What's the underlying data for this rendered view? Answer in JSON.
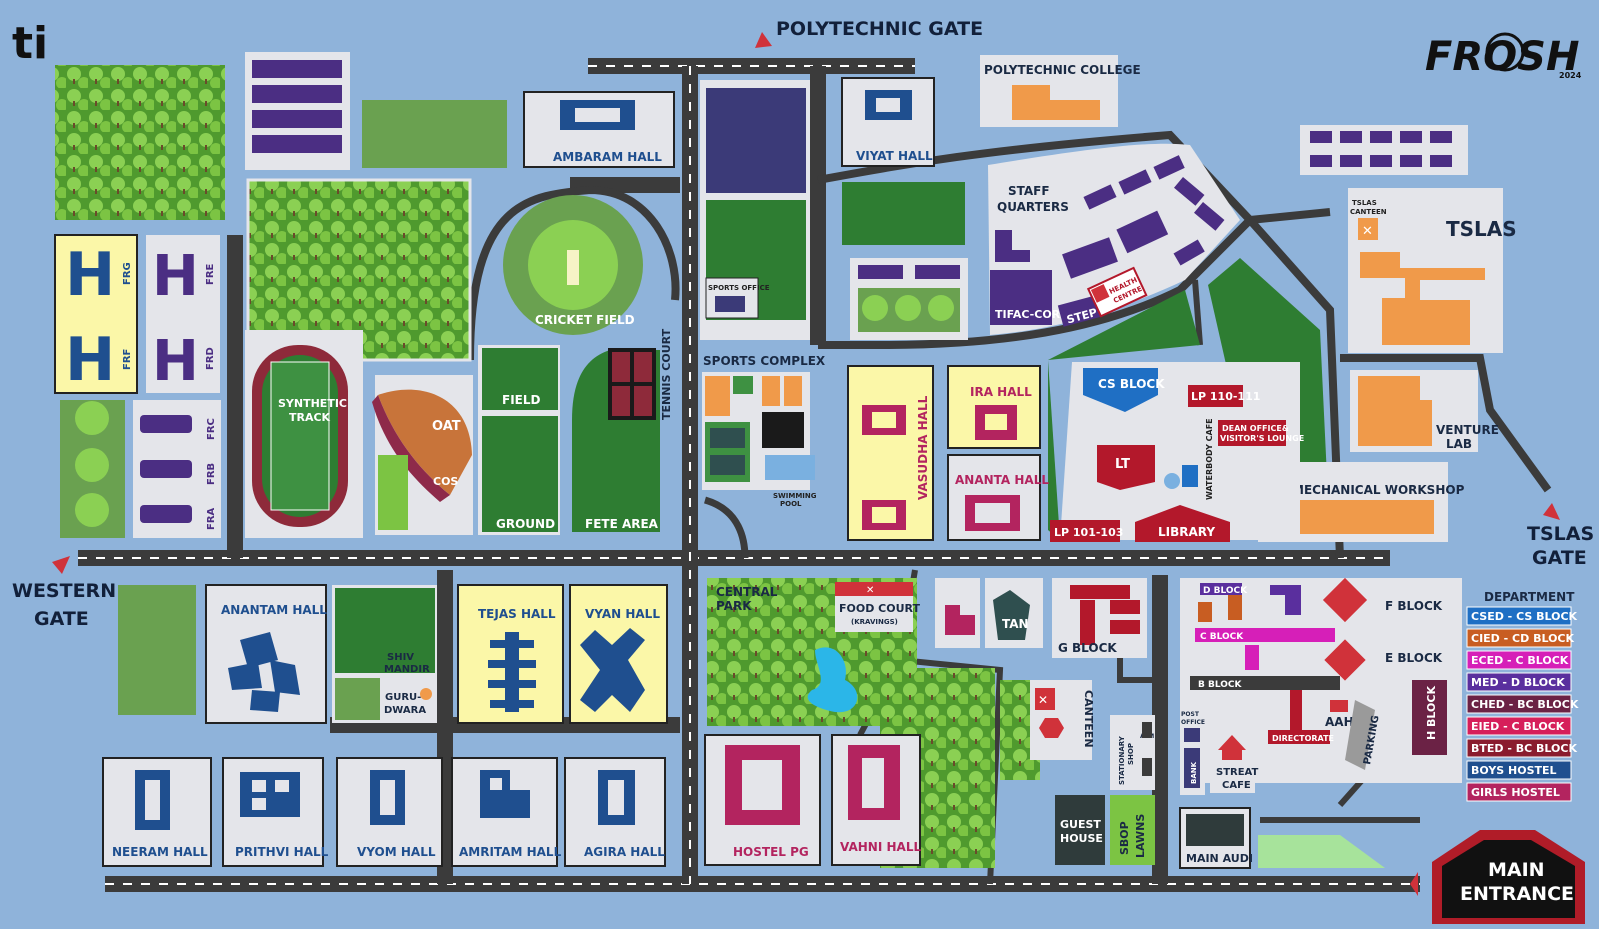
{
  "logo_left": "ti",
  "logo_right": {
    "text": "FROSH",
    "year": "2024"
  },
  "gates": {
    "polytechnic": "POLYTECHNIC GATE",
    "western_1": "WESTERN",
    "western_2": "GATE",
    "tslas_1": "TSLAS",
    "tslas_2": "GATE",
    "main_1": "MAIN",
    "main_2": "ENTRANCE"
  },
  "places": {
    "ambaram": "AMBARAM HALL",
    "viyat": "VIYAT HALL",
    "polytechnic_college": "POLYTECHNIC COLLEGE",
    "staff_1": "STAFF",
    "staff_2": "QUARTERS",
    "tifac": "TIFAC-CORE",
    "step": "STEP",
    "health_1": "HEALTH",
    "health_2": "CENTRE",
    "tslas": "TSLAS",
    "tslas_canteen_1": "TSLAS",
    "tslas_canteen_2": "CANTEEN",
    "frg": "FRG",
    "fre": "FRE",
    "frf": "FRF",
    "frd": "FRD",
    "frc": "FRC",
    "frb": "FRB",
    "fra": "FRA",
    "synthetic_1": "SYNTHETIC",
    "synthetic_2": "TRACK",
    "oat": "OAT",
    "cos": "COS",
    "cricket": "CRICKET FIELD",
    "field": "FIELD",
    "ground": "GROUND",
    "fete": "FETE AREA",
    "tennis": "TENNIS COURT",
    "sports_office": "SPORTS OFFICE",
    "sports_complex": "SPORTS COMPLEX",
    "swimming_1": "SWIMMING",
    "swimming_2": "POOL",
    "vasudha": "VASUDHA HALL",
    "ira": "IRA HALL",
    "ananta": "ANANTA HALL",
    "cs_block": "CS BLOCK",
    "lp110": "LP 110-111",
    "dean_1": "DEAN OFFICE&",
    "dean_2": "VISITOR'S LOUNGE",
    "lt": "LT",
    "waterbody": "WATERBODY CAFE",
    "lp101": "LP 101-103",
    "library": "LIBRARY",
    "venture_1": "VENTURE",
    "venture_2": "LAB",
    "workshop": "MECHANICAL WORKSHOP",
    "anantam": "ANANTAM HALL",
    "shiv_1": "SHIV",
    "shiv_2": "MANDIR",
    "guru_1": "GURU-",
    "guru_2": "DWARA",
    "tejas": "TEJAS HALL",
    "vyan": "VYAN HALL",
    "central_1": "CENTRAL",
    "central_2": "PARK",
    "food_court": "FOOD COURT",
    "kravings": "(KRAVINGS)",
    "tan": "TAN",
    "g_block": "G BLOCK",
    "canteen": "CANTEEN",
    "stationary": "STATIONARY",
    "shop": "SHOP",
    "atm": "ATM",
    "guest_1": "GUEST",
    "guest_2": "HOUSE",
    "sbop_1": "SBOP",
    "sbop_2": "LAWNS",
    "d_block": "D BLOCK",
    "c_block": "C BLOCK",
    "b_block": "B BLOCK",
    "f_block": "F BLOCK",
    "e_block": "E BLOCK",
    "aahar": "AAHAR",
    "directorate": "DIRECTORATE",
    "parking": "PARKING",
    "h_block": "H BLOCK",
    "post_1": "POST",
    "post_2": "OFFICE",
    "bank": "BANK",
    "streat_1": "STREAT",
    "streat_2": "CAFE",
    "main_audi": "MAIN AUDI",
    "neeram": "NEERAM HALL",
    "prithvi": "PRITHVI HALL",
    "vyom": "VYOM HALL",
    "amritam": "AMRITAM HALL",
    "agira": "AGIRA HALL",
    "hostel_pg": "HOSTEL PG",
    "vahni": "VAHNI HALL"
  },
  "legend": {
    "title": "DEPARTMENT",
    "items": [
      {
        "label": "CSED - CS BLOCK",
        "color": "#1f6fc4"
      },
      {
        "label": "CIED - CD BLOCK",
        "color": "#c85d22"
      },
      {
        "label": "ECED - C BLOCK",
        "color": "#d61fb8"
      },
      {
        "label": "MED - D BLOCK",
        "color": "#5a2f9e"
      },
      {
        "label": "CHED - BC BLOCK",
        "color": "#6b2245"
      },
      {
        "label": "EIED - C BLOCK",
        "color": "#d61f5a"
      },
      {
        "label": "BTED - BC BLOCK",
        "color": "#8a1c2e"
      },
      {
        "label": "BOYS HOSTEL",
        "color": "#1f4f8f"
      },
      {
        "label": "GIRLS HOSTEL",
        "color": "#b3245f"
      }
    ]
  },
  "colors": {
    "background": "#8fb3da",
    "road": "#3b3b3b",
    "lot": "#e4e5ea",
    "grass": "#2e7d32",
    "tree": "#6fbf3b",
    "boys_hostel": "#1f4f8f",
    "girls_hostel": "#b3245f",
    "purple_building": "#4b2e83",
    "orange_building": "#f09a4a",
    "red_building": "#b3182b",
    "yellow_lot": "#fbf7a8"
  }
}
